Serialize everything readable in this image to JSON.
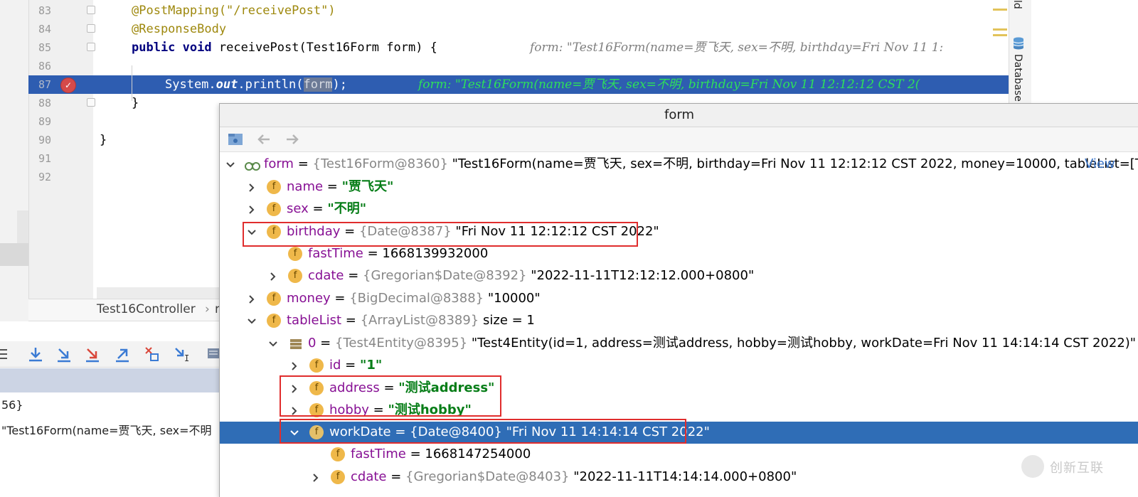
{
  "editor": {
    "lines": [
      {
        "num": "83",
        "code": "@PostMapping(\"/receivePost\")"
      },
      {
        "num": "84",
        "code": "@ResponseBody"
      },
      {
        "num": "85",
        "code_kw1": "public",
        "code_kw2": "void",
        "code_rest": " receivePost(Test16Form form) {",
        "hint": "form: \"Test16Form(name=贾飞天, sex=不明, birthday=Fri Nov 11 1:"
      },
      {
        "num": "86"
      },
      {
        "num": "87",
        "code_pre": "System.",
        "code_out": "out",
        "code_mid": ".println(",
        "code_sel": "form",
        "code_end": ");",
        "hint": "form: \"Test16Form(name=贾飞天, sex=不明, birthday=Fri Nov 11 12:12:12 CST 2("
      },
      {
        "num": "88",
        "code": "}"
      },
      {
        "num": "89"
      },
      {
        "num": "90",
        "code": "}"
      },
      {
        "num": "91"
      },
      {
        "num": "92"
      }
    ],
    "right_tab_1": "ld",
    "right_tab_2": "Database"
  },
  "breadcrumb": {
    "file": "Test16Controller",
    "sep": "›",
    "next": "r"
  },
  "debug": {
    "frame_1": "56}",
    "frame_2": "\"Test16Form(name=贾飞天, sex=不明"
  },
  "popup": {
    "title": "form",
    "view_link": "View",
    "rows": {
      "form": {
        "name": "form",
        "type": "{Test16Form@8360}",
        "value": "\"Test16Form(name=贾飞天, sex=不明, birthday=Fri Nov 11 12:12:12 CST 2022, money=10000, tableList=[T..."
      },
      "name": {
        "badge": "f",
        "name": "name",
        "value": "\"贾飞天\""
      },
      "sex": {
        "badge": "f",
        "name": "sex",
        "value": "\"不明\""
      },
      "birthday": {
        "badge": "f",
        "name": "birthday",
        "type": "{Date@8387}",
        "value": "\"Fri Nov 11 12:12:12 CST 2022\""
      },
      "fastTime1": {
        "badge": "f",
        "name": "fastTime",
        "value": "1668139932000"
      },
      "cdate1": {
        "badge": "f",
        "name": "cdate",
        "type": "{Gregorian$Date@8392}",
        "value": "\"2022-11-11T12:12:12.000+0800\""
      },
      "money": {
        "badge": "f",
        "name": "money",
        "type": "{BigDecimal@8388}",
        "value": "\"10000\""
      },
      "tableList": {
        "badge": "f",
        "name": "tableList",
        "type": "{ArrayList@8389}",
        "value": " size = 1"
      },
      "item0": {
        "name": "0",
        "type": "{Test4Entity@8395}",
        "value": "\"Test4Entity(id=1, address=测试address, hobby=测试hobby, workDate=Fri Nov 11 14:14:14 CST 2022)\""
      },
      "id": {
        "badge": "f",
        "name": "id",
        "value": "\"1\""
      },
      "address": {
        "badge": "f",
        "name": "address",
        "value": "\"测试address\""
      },
      "hobby": {
        "badge": "f",
        "name": "hobby",
        "value": "\"测试hobby\""
      },
      "workDate": {
        "badge": "f",
        "name": "workDate",
        "type": "{Date@8400}",
        "value": "\"Fri Nov 11 14:14:14 CST 2022\""
      },
      "fastTime2": {
        "badge": "f",
        "name": "fastTime",
        "value": "1668147254000"
      },
      "cdate2": {
        "badge": "f",
        "name": "cdate",
        "type": "{Gregorian$Date@8403}",
        "value": "\"2022-11-11T14:14:14.000+0800\""
      }
    },
    "eq": " = "
  },
  "watermark": {
    "text": "创新互联"
  },
  "colors": {
    "selection": "#2f6db6",
    "highlight_line": "#2e5db1",
    "red_box": "#e02d2d",
    "string_green": "#067d17",
    "field_purple": "#871094"
  },
  "icons": [
    "breakpoint-icon",
    "chevron-right-icon",
    "chevron-down-icon",
    "field-icon",
    "watch-icon",
    "list-icon",
    "database-icon",
    "back-arrow-icon",
    "forward-arrow-icon",
    "step-over-icon",
    "step-into-icon"
  ]
}
